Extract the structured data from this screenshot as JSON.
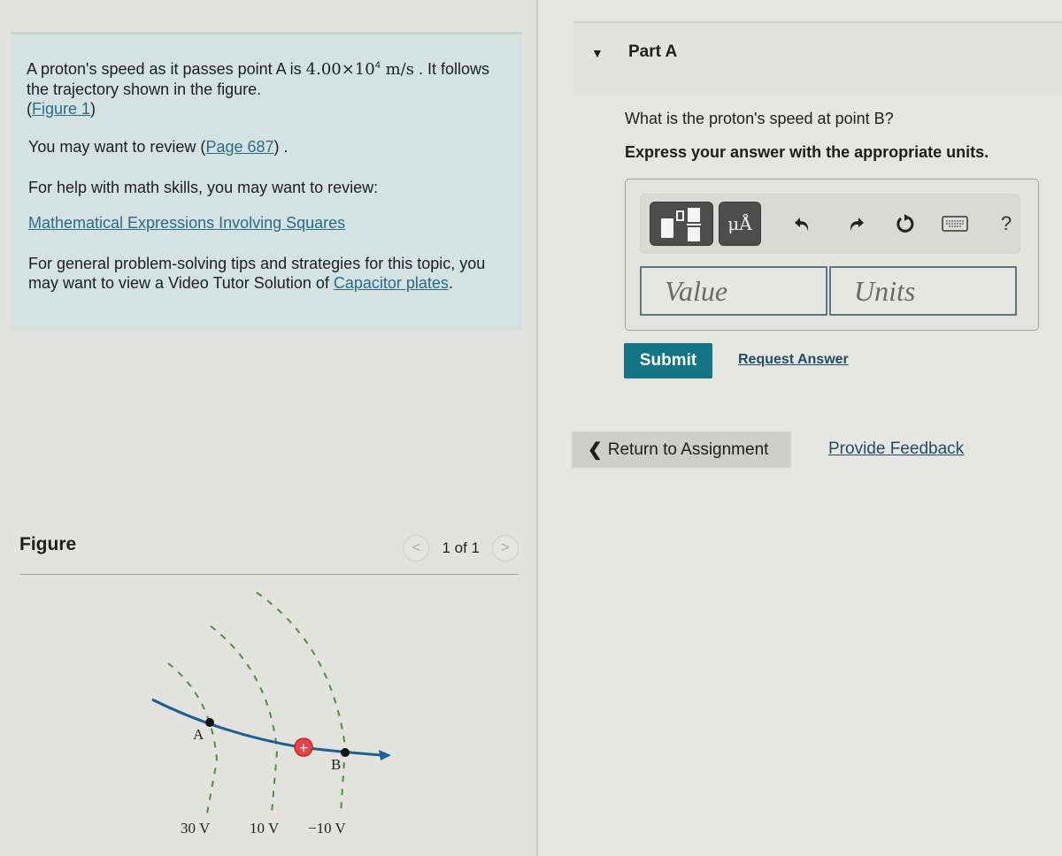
{
  "problem": {
    "intro_before_value": "A proton's speed as it passes point A is ",
    "speed_value": "4.00×10",
    "speed_exponent": "4",
    "speed_unit": "m/s",
    "intro_after_value": " . It follows the trajectory shown in the figure.",
    "figure_link_open": "(",
    "figure_link": "Figure 1",
    "figure_link_close": ")",
    "review_prefix": "You may want to review (",
    "review_link": "Page 687",
    "review_suffix": ") .",
    "math_help_text": "For help with math skills, you may want to review:",
    "math_help_link": "Mathematical Expressions Involving Squares",
    "tips_text": "For general problem-solving tips and strategies for this topic, you may want to view a Video Tutor Solution of ",
    "tips_link": "Capacitor plates",
    "tips_suffix": "."
  },
  "figure": {
    "title": "Figure",
    "pager_text": "1 of 1",
    "prev_glyph": "<",
    "next_glyph": ">",
    "point_a_label": "A",
    "point_b_label": "B",
    "proton_symbol": "+",
    "equipotentials": [
      {
        "label": "30 V",
        "color": "#4f8f3c"
      },
      {
        "label": "10 V",
        "color": "#4f8f3c"
      },
      {
        "label": "−10 V",
        "color": "#4f8f3c"
      }
    ],
    "trajectory_color": "#1d5f94",
    "proton_color": "#e0474a"
  },
  "part": {
    "toggle_glyph": "▼",
    "title": "Part A",
    "question": "What is the proton's speed at point B?",
    "instruction": "Express your answer with the appropriate units."
  },
  "answer": {
    "units_button_label": "μÅ",
    "help_label": "?",
    "value_placeholder": "Value",
    "units_placeholder": "Units"
  },
  "actions": {
    "submit_label": "Submit",
    "request_answer_label": "Request Answer",
    "return_chevron": "❮",
    "return_label": "Return to Assignment",
    "feedback_label": "Provide Feedback"
  },
  "colors": {
    "submit_bg": "#137486",
    "link": "#2a6b8a",
    "intro_bg": "#d4e2e1"
  }
}
